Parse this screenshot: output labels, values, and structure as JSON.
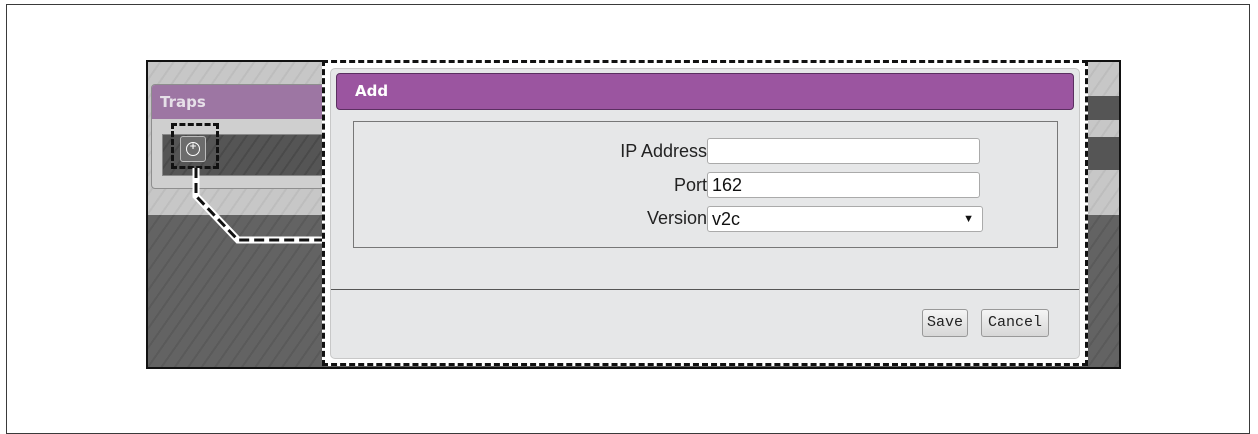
{
  "traps_panel": {
    "title": "Traps",
    "add_icon": "plus-circle-icon"
  },
  "dialog": {
    "title": "Add",
    "fields": {
      "ip_address": {
        "label": "IP Address",
        "value": ""
      },
      "port": {
        "label": "Port",
        "value": "162"
      },
      "version": {
        "label": "Version",
        "value": "v2c"
      }
    },
    "buttons": {
      "save": "Save",
      "cancel": "Cancel"
    }
  },
  "colors": {
    "dialog_header": "#9b55a0",
    "panel_header": "#9d76a3",
    "dialog_body": "#e6e7e8"
  }
}
